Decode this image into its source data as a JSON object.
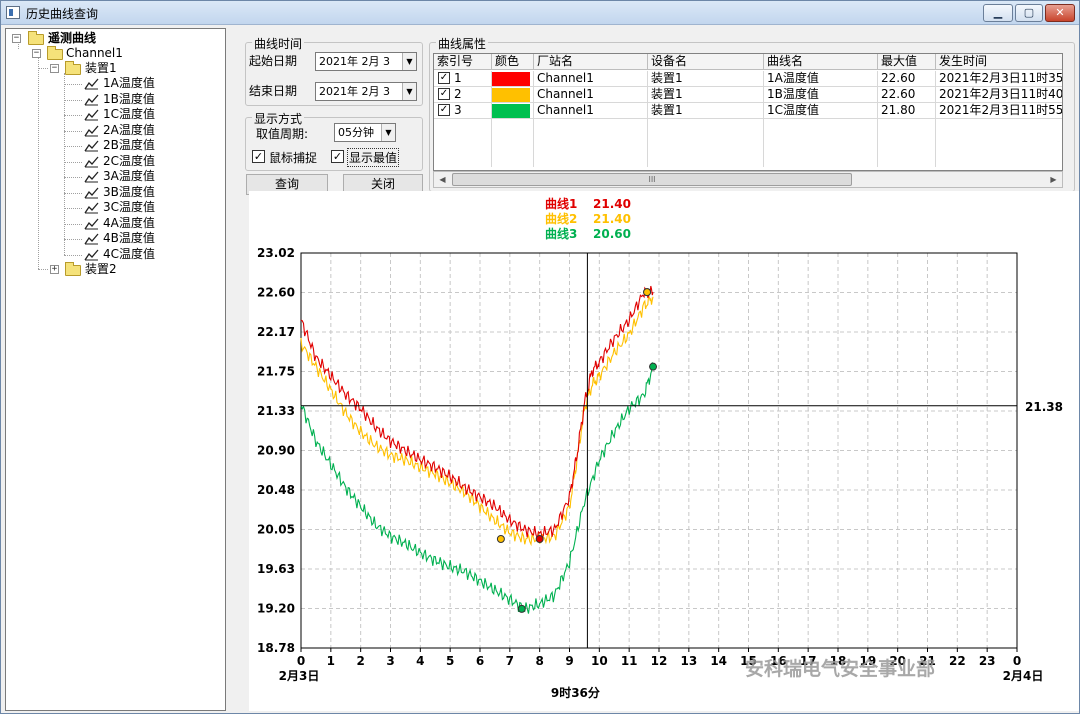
{
  "window": {
    "title": "历史曲线查询",
    "minimize": "▁",
    "maximize": "▢",
    "close": "✕"
  },
  "tree": {
    "root": "遥测曲线",
    "channel": "Channel1",
    "device1": "装置1",
    "items": [
      "1A温度值",
      "1B温度值",
      "1C温度值",
      "2A温度值",
      "2B温度值",
      "2C温度值",
      "3A温度值",
      "3B温度值",
      "3C温度值",
      "4A温度值",
      "4B温度值",
      "4C温度值"
    ],
    "device2": "装置2"
  },
  "curve_time": {
    "title": "曲线时间",
    "start_label": "起始日期",
    "start_value": "2021年 2月 3",
    "end_label": "结束日期",
    "end_value": "2021年 2月 3"
  },
  "display": {
    "title": "显示方式",
    "period_label": "取值周期:",
    "period_value": "05分钟",
    "mouse_capture": "鼠标捕捉",
    "show_extremes": "显示最值"
  },
  "buttons": {
    "query": "查询",
    "close": "关闭"
  },
  "properties": {
    "title": "曲线属性",
    "columns": [
      "索引号",
      "颜色",
      "厂站名",
      "设备名",
      "曲线名",
      "最大值",
      "发生时间"
    ],
    "rows": [
      {
        "index": "1",
        "color": "#ff0000",
        "station": "Channel1",
        "device": "装置1",
        "curve": "1A温度值",
        "max": "22.60",
        "time": "2021年2月3日11时35"
      },
      {
        "index": "2",
        "color": "#ffc000",
        "station": "Channel1",
        "device": "装置1",
        "curve": "1B温度值",
        "max": "22.60",
        "time": "2021年2月3日11时40"
      },
      {
        "index": "3",
        "color": "#00c050",
        "station": "Channel1",
        "device": "装置1",
        "curve": "1C温度值",
        "max": "21.80",
        "time": "2021年2月3日11时55"
      }
    ],
    "scroll_grip": "III"
  },
  "chart_data": {
    "type": "line",
    "readouts": [
      {
        "label": "曲线1",
        "value": "21.40",
        "color": "#e00000"
      },
      {
        "label": "曲线2",
        "value": "21.40",
        "color": "#ffc000"
      },
      {
        "label": "曲线3",
        "value": "20.60",
        "color": "#00b050"
      }
    ],
    "y_ticks": [
      "23.02",
      "22.60",
      "22.17",
      "21.75",
      "21.33",
      "20.90",
      "20.48",
      "20.05",
      "19.63",
      "19.20",
      "18.78"
    ],
    "ylim": [
      18.78,
      23.02
    ],
    "x_ticks": [
      "0",
      "1",
      "2",
      "3",
      "4",
      "5",
      "6",
      "7",
      "8",
      "9",
      "10",
      "11",
      "12",
      "13",
      "14",
      "15",
      "16",
      "17",
      "18",
      "19",
      "20",
      "21",
      "22",
      "23",
      "0"
    ],
    "xlim": [
      0,
      24
    ],
    "x_start_label": "2月3日",
    "x_end_label": "2月4日",
    "cursor_time_label": "9时36分",
    "cursor_x": 9.6,
    "cursor_y": 21.38,
    "cursor_value_label": "21.38",
    "grid": true,
    "series": [
      {
        "name": "曲线1",
        "color": "#e00000",
        "x": [
          0,
          0.5,
          1,
          1.5,
          2,
          2.5,
          3,
          3.5,
          4,
          4.5,
          5,
          5.5,
          6,
          6.5,
          7,
          7.5,
          8,
          8.5,
          9,
          9.25,
          9.5,
          9.75,
          10,
          10.5,
          11,
          11.5,
          11.8
        ],
        "y": [
          22.3,
          21.9,
          21.7,
          21.5,
          21.35,
          21.15,
          21.0,
          20.9,
          20.8,
          20.72,
          20.62,
          20.5,
          20.4,
          20.3,
          20.15,
          20.05,
          20.0,
          20.05,
          20.4,
          20.85,
          21.4,
          21.75,
          21.85,
          22.1,
          22.3,
          22.6,
          22.6
        ],
        "min": {
          "x": 8.0,
          "y": 19.95
        },
        "max": {
          "x": 11.6,
          "y": 22.6
        }
      },
      {
        "name": "曲线2",
        "color": "#ffc000",
        "x": [
          0,
          0.5,
          1,
          1.5,
          2,
          2.5,
          3,
          3.5,
          4,
          4.5,
          5,
          5.5,
          6,
          6.5,
          7,
          7.5,
          8,
          8.5,
          9,
          9.25,
          9.5,
          9.75,
          10,
          10.5,
          11,
          11.5,
          11.8
        ],
        "y": [
          22.05,
          21.8,
          21.55,
          21.3,
          21.1,
          20.95,
          20.85,
          20.8,
          20.72,
          20.65,
          20.55,
          20.45,
          20.3,
          20.15,
          20.02,
          19.95,
          19.95,
          19.98,
          20.3,
          20.8,
          21.35,
          21.6,
          21.7,
          21.95,
          22.15,
          22.45,
          22.55
        ],
        "min": {
          "x": 6.7,
          "y": 19.95
        },
        "max": {
          "x": 11.6,
          "y": 22.6
        }
      },
      {
        "name": "曲线3",
        "color": "#00b050",
        "x": [
          0,
          0.5,
          1,
          1.5,
          2,
          2.5,
          3,
          3.5,
          4,
          4.5,
          5,
          5.5,
          6,
          6.5,
          7,
          7.5,
          8,
          8.5,
          9,
          9.5,
          10,
          10.5,
          11,
          11.5,
          11.8
        ],
        "y": [
          21.4,
          21.0,
          20.75,
          20.5,
          20.3,
          20.1,
          19.98,
          19.9,
          19.8,
          19.72,
          19.65,
          19.6,
          19.5,
          19.4,
          19.3,
          19.2,
          19.25,
          19.35,
          19.7,
          20.35,
          20.8,
          21.1,
          21.35,
          21.5,
          21.8
        ],
        "min": {
          "x": 7.4,
          "y": 19.2
        },
        "max": {
          "x": 11.8,
          "y": 21.8
        }
      }
    ]
  },
  "watermark": "安科瑞电气安全事业部"
}
